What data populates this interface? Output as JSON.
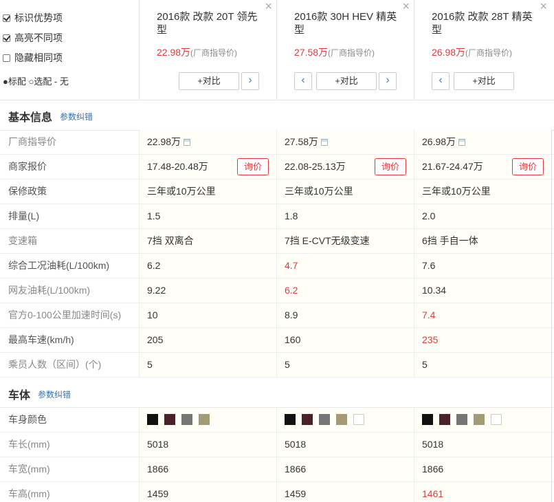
{
  "options": {
    "highlight_advantage": "标识优势项",
    "highlight_diff": "高亮不同项",
    "hide_same": "隐藏相同项",
    "legend": "●标配 ○选配  - 无"
  },
  "cars": [
    {
      "name": "2016款 改款 20T 领先型",
      "price": "22.98万",
      "price_note": "(厂商指导价)",
      "compare_label": "+对比"
    },
    {
      "name": "2016款 30H HEV 精英型",
      "price": "27.58万",
      "price_note": "(厂商指导价)",
      "compare_label": "+对比"
    },
    {
      "name": "2016款 改款 28T 精英型",
      "price": "26.98万",
      "price_note": "(厂商指导价)",
      "compare_label": "+对比"
    }
  ],
  "close_glyph": "×",
  "sections": {
    "basic": {
      "title": "基本信息",
      "link": "参数纠错"
    },
    "body": {
      "title": "车体",
      "link": "参数纠错"
    }
  },
  "ask_label": "询价",
  "basic_rows": [
    {
      "label": "厂商指导价",
      "values": [
        "22.98万",
        "27.58万",
        "26.98万"
      ]
    },
    {
      "label": "商家报价",
      "values": [
        "17.48-20.48万",
        "22.08-25.13万",
        "21.67-24.47万"
      ]
    },
    {
      "label": "保修政策",
      "values": [
        "三年或10万公里",
        "三年或10万公里",
        "三年或10万公里"
      ]
    },
    {
      "label": "排量(L)",
      "values": [
        "1.5",
        "1.8",
        "2.0"
      ]
    },
    {
      "label": "变速箱",
      "values": [
        "7挡 双离合",
        "7挡 E-CVT无级变速",
        "6挡 手自一体"
      ]
    },
    {
      "label": "综合工况油耗(L/100km)",
      "values": [
        "6.2",
        "4.7",
        "7.6"
      ]
    },
    {
      "label": "网友油耗(L/100km)",
      "values": [
        "9.22",
        "6.2",
        "10.34"
      ]
    },
    {
      "label": "官方0-100公里加速时间(s)",
      "values": [
        "10",
        "8.9",
        "7.4"
      ]
    },
    {
      "label": "最高车速(km/h)",
      "values": [
        "205",
        "160",
        "235"
      ]
    },
    {
      "label": "乘员人数（区间）(个)",
      "values": [
        "5",
        "5",
        "5"
      ]
    }
  ],
  "body_rows": [
    {
      "label": "车身颜色"
    },
    {
      "label": "车长(mm)",
      "values": [
        "5018",
        "5018",
        "5018"
      ]
    },
    {
      "label": "车宽(mm)",
      "values": [
        "1866",
        "1866",
        "1866"
      ]
    },
    {
      "label": "车高(mm)",
      "values": [
        "1459",
        "1459",
        "1461"
      ]
    }
  ],
  "colors": {
    "car1": [
      "#111111",
      "#4a2328",
      "#767676",
      "#a39a76"
    ],
    "car2": [
      "#111111",
      "#4a2328",
      "#767676",
      "#a39a76",
      "#ffffff"
    ],
    "car3": [
      "#111111",
      "#4a2328",
      "#767676",
      "#a39a76",
      "#ffffff"
    ]
  },
  "accent_red": "#e4393c",
  "link_blue": "#3a6ea5"
}
